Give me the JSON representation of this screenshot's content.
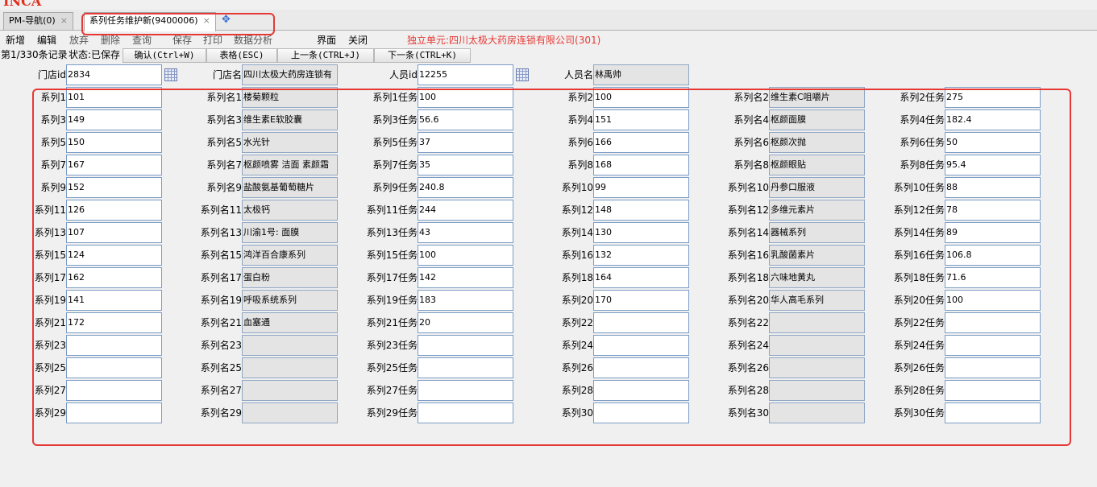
{
  "tabs": [
    {
      "label": "PM-导航(0)",
      "active": false
    },
    {
      "label": "系列任务维护新(9400006)",
      "active": true
    }
  ],
  "toolbar": {
    "buttons": [
      "新增",
      "编辑",
      "放弃",
      "删除",
      "查询",
      "保存",
      "打印",
      "数据分析",
      "界面",
      "关闭"
    ],
    "unit": "独立单元:四川太极大药房连锁有限公司(301)"
  },
  "status": {
    "record": "第1/330条记录",
    "state": "状态:已保存",
    "buttons": [
      "确认(Ctrl+W)",
      "表格(ESC)",
      "上一条(CTRL+J)",
      "下一条(CTRL+K)"
    ]
  },
  "header": {
    "store_id_label": "门店id",
    "store_id": "2834",
    "store_name_label": "门店名",
    "store_name": "四川太极大药房连锁有",
    "person_id_label": "人员id",
    "person_id": "12255",
    "person_name_label": "人员名",
    "person_name": "林禹帅"
  },
  "series": [
    {
      "n": "1",
      "id": "101",
      "name": "楼菊颗粒",
      "task": "100"
    },
    {
      "n": "2",
      "id": "100",
      "name": "维生素C咀嚼片",
      "task": "275"
    },
    {
      "n": "3",
      "id": "149",
      "name": "维生素E软胶囊",
      "task": "56.6"
    },
    {
      "n": "4",
      "id": "151",
      "name": "枢颜面膜",
      "task": "182.4"
    },
    {
      "n": "5",
      "id": "150",
      "name": "水光针",
      "task": "37"
    },
    {
      "n": "6",
      "id": "166",
      "name": "枢颜次抛",
      "task": "50"
    },
    {
      "n": "7",
      "id": "167",
      "name": "枢颜喷雾 洁面 素颜霜",
      "task": "35"
    },
    {
      "n": "8",
      "id": "168",
      "name": "枢颜眼贴",
      "task": "95.4"
    },
    {
      "n": "9",
      "id": "152",
      "name": "盐酸氨基葡萄糖片",
      "task": "240.8"
    },
    {
      "n": "10",
      "id": "99",
      "name": "丹参口服液",
      "task": "88"
    },
    {
      "n": "11",
      "id": "126",
      "name": "太极钙",
      "task": "244"
    },
    {
      "n": "12",
      "id": "148",
      "name": "多维元素片",
      "task": "78"
    },
    {
      "n": "13",
      "id": "107",
      "name": "川渝1号: 面膜",
      "task": "43"
    },
    {
      "n": "14",
      "id": "130",
      "name": "器械系列",
      "task": "89"
    },
    {
      "n": "15",
      "id": "124",
      "name": "鸿洋百合康系列",
      "task": "100"
    },
    {
      "n": "16",
      "id": "132",
      "name": "乳酸菌素片",
      "task": "106.8"
    },
    {
      "n": "17",
      "id": "162",
      "name": "蛋白粉",
      "task": "142"
    },
    {
      "n": "18",
      "id": "164",
      "name": "六味地黄丸",
      "task": "71.6"
    },
    {
      "n": "19",
      "id": "141",
      "name": "呼吸系统系列",
      "task": "183"
    },
    {
      "n": "20",
      "id": "170",
      "name": "华人高毛系列",
      "task": "100"
    },
    {
      "n": "21",
      "id": "172",
      "name": "血塞通",
      "task": "20"
    },
    {
      "n": "22",
      "id": "",
      "name": "",
      "task": ""
    },
    {
      "n": "23",
      "id": "",
      "name": "",
      "task": ""
    },
    {
      "n": "24",
      "id": "",
      "name": "",
      "task": ""
    },
    {
      "n": "25",
      "id": "",
      "name": "",
      "task": ""
    },
    {
      "n": "26",
      "id": "",
      "name": "",
      "task": ""
    },
    {
      "n": "27",
      "id": "",
      "name": "",
      "task": ""
    },
    {
      "n": "28",
      "id": "",
      "name": "",
      "task": ""
    },
    {
      "n": "29",
      "id": "",
      "name": "",
      "task": ""
    },
    {
      "n": "30",
      "id": "",
      "name": "",
      "task": ""
    }
  ],
  "labels": {
    "series": "系列",
    "series_name": "系列名",
    "task": "任务"
  },
  "colors": {
    "highlight": "#e53935",
    "field_border": "#7a9cc6",
    "readonly_bg": "#e4e4e4"
  }
}
